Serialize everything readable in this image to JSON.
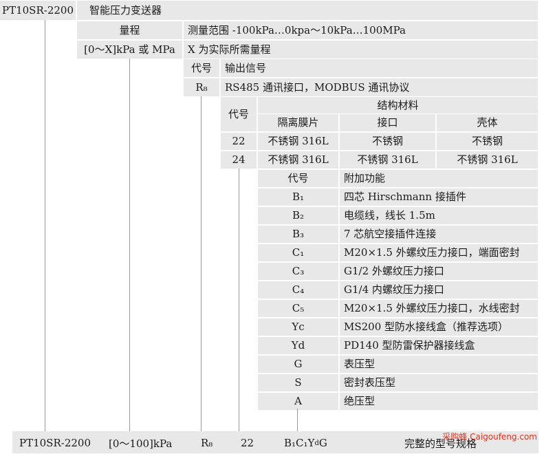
{
  "model_row": {
    "code": "PT10SR-2200",
    "name": "智能压力变送器"
  },
  "range": {
    "label": "量程",
    "desc": "测量范围 -100kPa…0kpa～10kPa…100MPa",
    "code": "[0～X]kPa 或 MPa",
    "code_desc": "X 为实际所需量程"
  },
  "output": {
    "header_code": "代号",
    "header_desc": "输出信号",
    "rows": [
      {
        "code": "R₈",
        "desc": "RS485 通讯接口，MODBUS 通讯协议"
      }
    ]
  },
  "material": {
    "header_code": "代号",
    "group_title": "结构材料",
    "columns": [
      "隔离膜片",
      "接口",
      "壳体"
    ],
    "rows": [
      {
        "code": "22",
        "cells": [
          "不锈钢 316L",
          "不锈钢",
          "不锈钢"
        ]
      },
      {
        "code": "24",
        "cells": [
          "不锈钢 316L",
          "不锈钢 316L",
          "不锈钢 316L"
        ]
      }
    ]
  },
  "extras": {
    "header_code": "代号",
    "header_desc": "附加功能",
    "rows": [
      {
        "code": "B₁",
        "desc": "四芯 Hirschmann 接插件"
      },
      {
        "code": "B₂",
        "desc": "电缆线，线长 1.5m"
      },
      {
        "code": "B₃",
        "desc": "7 芯航空接插件连接"
      },
      {
        "code": "C₁",
        "desc": "M20×1.5 外螺纹压力接口，端面密封"
      },
      {
        "code": "C₃",
        "desc": "G1/2 外螺纹压力接口"
      },
      {
        "code": "C₄",
        "desc": "G1/4 内螺纹压力接口"
      },
      {
        "code": "C₅",
        "desc": "M20×1.5 外螺纹压力接口，水线密封"
      },
      {
        "code": "Yc",
        "desc": "MS200 型防水接线盒（推荐选项）"
      },
      {
        "code": "Yd",
        "desc": "PD140 型防雷保护器接线盒"
      },
      {
        "code": "G",
        "desc": "表压型"
      },
      {
        "code": "S",
        "desc": "密封表压型"
      },
      {
        "code": "A",
        "desc": "绝压型"
      }
    ]
  },
  "example": {
    "model": "PT10SR-2200",
    "range": "[0～100]kPa",
    "output": "R₈",
    "material": "22",
    "extras": "B₁C₁Y_dG",
    "caption": "完整的型号规格"
  },
  "watermark": "采购蜂 Caigoufeng.com"
}
